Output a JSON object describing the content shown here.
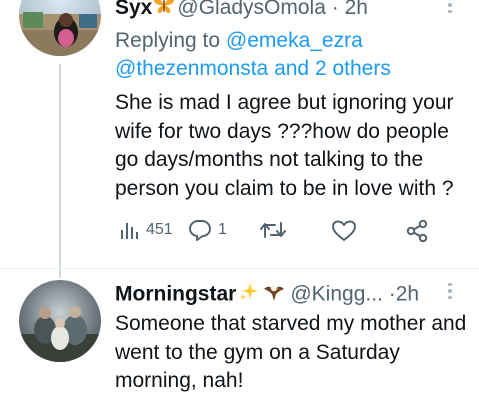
{
  "tweet1": {
    "author_name": "Syx",
    "handle": "@GladysOmola",
    "separator": "·",
    "time": "2h",
    "reply_prefix": "Replying to",
    "reply_to_1": "@emeka_ezra",
    "reply_to_2": "@thezenmonsta and 2 others",
    "text": "She is mad I agree but ignoring your wife for two days ???how do people go days/months not talking to the person you claim to be in love with ?",
    "views": "451",
    "replies": "1",
    "icons": [
      "butterfly-emoji",
      "views-icon",
      "reply-icon",
      "retweet-icon",
      "like-icon",
      "share-icon",
      "more-icon"
    ]
  },
  "tweet2": {
    "author_name": "Morningstar",
    "handle": "@Kingg...",
    "separator": "·",
    "time": "2h",
    "text": "Someone that starved my mother and went to the gym on a Saturday morning, nah!",
    "icons": [
      "sparkles-emoji",
      "eagle-emoji",
      "more-icon"
    ]
  },
  "colors": {
    "link": "#1d9bf0",
    "muted": "#536471",
    "thread_line": "#cfd9de"
  }
}
